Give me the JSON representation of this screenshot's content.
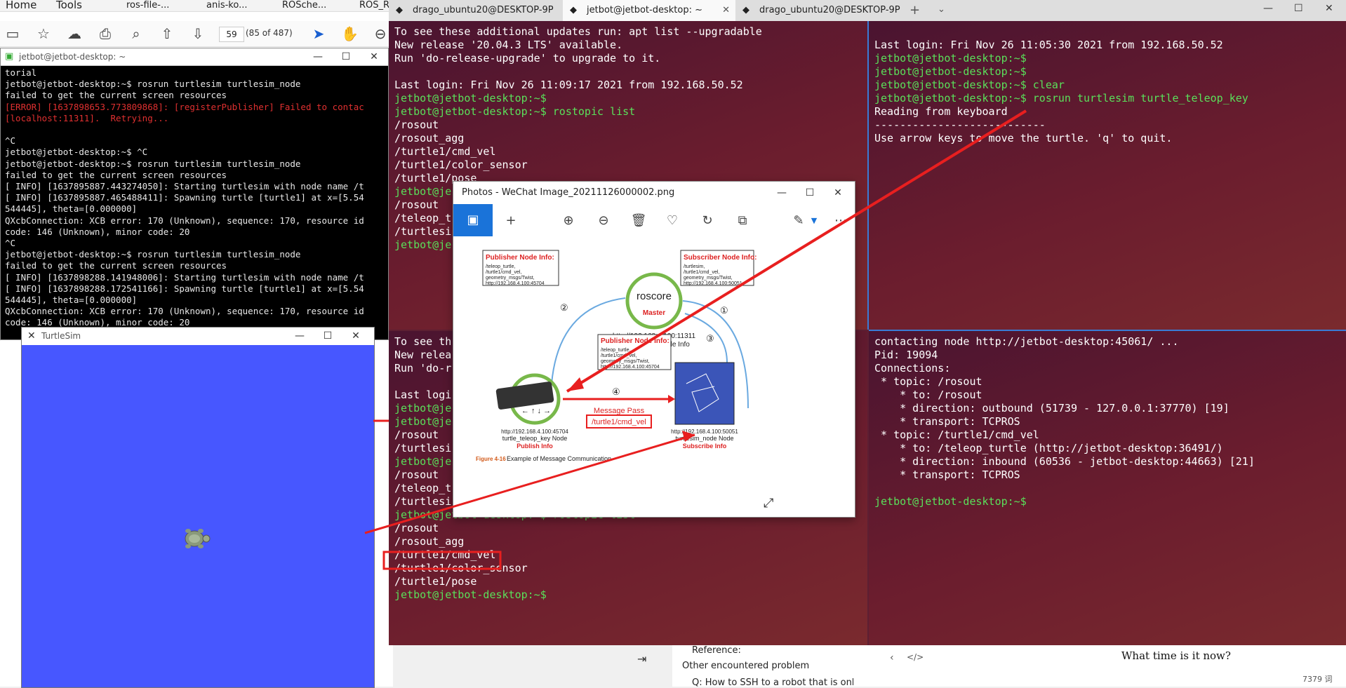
{
  "pdf_reader": {
    "menu": [
      "Home",
      "Tools"
    ],
    "tabs": [
      "ros-file-...",
      "anis-ko...",
      "ROSche...",
      "ROS_R"
    ],
    "page_input": "59",
    "page_count": "(85 of 487)"
  },
  "putty": {
    "title": "jetbot@jetbot-desktop: ~",
    "lines": [
      {
        "t": "torial",
        "c": ""
      },
      {
        "t": "jetbot@jetbot-desktop:~$ rosrun turtlesim turtlesim_node",
        "c": ""
      },
      {
        "t": "failed to get the current screen resources",
        "c": ""
      },
      {
        "t": "[ERROR] [1637898653.773809868]: [registerPublisher] Failed to contac",
        "c": "red"
      },
      {
        "t": "[localhost:11311].  Retrying...",
        "c": "red"
      },
      {
        "t": "",
        "c": ""
      },
      {
        "t": "^C",
        "c": ""
      },
      {
        "t": "jetbot@jetbot-desktop:~$ ^C",
        "c": ""
      },
      {
        "t": "jetbot@jetbot-desktop:~$ rosrun turtlesim turtlesim_node",
        "c": ""
      },
      {
        "t": "failed to get the current screen resources",
        "c": ""
      },
      {
        "t": "[ INFO] [1637895887.443274050]: Starting turtlesim with node name /t",
        "c": ""
      },
      {
        "t": "[ INFO] [1637895887.465488411]: Spawning turtle [turtle1] at x=[5.54",
        "c": ""
      },
      {
        "t": "544445], theta=[0.000000]",
        "c": ""
      },
      {
        "t": "QXcbConnection: XCB error: 170 (Unknown), sequence: 170, resource id",
        "c": ""
      },
      {
        "t": "code: 146 (Unknown), minor code: 20",
        "c": ""
      },
      {
        "t": "^C",
        "c": ""
      },
      {
        "t": "jetbot@jetbot-desktop:~$ rosrun turtlesim turtlesim_node",
        "c": ""
      },
      {
        "t": "failed to get the current screen resources",
        "c": ""
      },
      {
        "t": "[ INFO] [1637898288.141948006]: Starting turtlesim with node name /t",
        "c": ""
      },
      {
        "t": "[ INFO] [1637898288.172541166]: Spawning turtle [turtle1] at x=[5.54",
        "c": ""
      },
      {
        "t": "544445], theta=[0.000000]",
        "c": ""
      },
      {
        "t": "QXcbConnection: XCB error: 170 (Unknown), sequence: 170, resource id",
        "c": ""
      },
      {
        "t": "code: 146 (Unknown), minor code: 20",
        "c": ""
      }
    ]
  },
  "turtlesim": {
    "title": "TurtleSim"
  },
  "terminal": {
    "tabs": [
      {
        "label": "drago_ubuntu20@DESKTOP-9P"
      },
      {
        "label": "jetbot@jetbot-desktop: ~"
      },
      {
        "label": "drago_ubuntu20@DESKTOP-9P"
      }
    ],
    "pane_top_left": [
      {
        "t": "To see these additional updates run: apt list --upgradable",
        "c": ""
      },
      {
        "t": "New release '20.04.3 LTS' available.",
        "c": ""
      },
      {
        "t": "Run 'do-release-upgrade' to upgrade to it.",
        "c": ""
      },
      {
        "t": "",
        "c": ""
      },
      {
        "t": "Last login: Fri Nov 26 11:09:17 2021 from 192.168.50.52",
        "c": ""
      },
      {
        "t": "jetbot@jetbot-desktop:~$",
        "c": "g"
      },
      {
        "t": "jetbot@jetbot-desktop:~$ rostopic list",
        "c": "g"
      },
      {
        "t": "/rosout",
        "c": ""
      },
      {
        "t": "/rosout_agg",
        "c": ""
      },
      {
        "t": "/turtle1/cmd_vel",
        "c": ""
      },
      {
        "t": "/turtle1/color_sensor",
        "c": ""
      },
      {
        "t": "/turtle1/pose",
        "c": ""
      },
      {
        "t": "jetbot@je",
        "c": "g"
      },
      {
        "t": "/rosout",
        "c": ""
      },
      {
        "t": "/teleop_t",
        "c": ""
      },
      {
        "t": "/turtlesi",
        "c": ""
      },
      {
        "t": "jetbot@je",
        "c": "g"
      }
    ],
    "pane_top_right": [
      {
        "t": "",
        "c": ""
      },
      {
        "t": "Last login: Fri Nov 26 11:05:30 2021 from 192.168.50.52",
        "c": ""
      },
      {
        "t": "jetbot@jetbot-desktop:~$",
        "c": "g"
      },
      {
        "t": "jetbot@jetbot-desktop:~$",
        "c": "g"
      },
      {
        "t": "jetbot@jetbot-desktop:~$ clear",
        "c": "g"
      },
      {
        "t": "jetbot@jetbot-desktop:~$ rosrun turtlesim turtle_teleop_key",
        "c": "g"
      },
      {
        "t": "Reading from keyboard",
        "c": ""
      },
      {
        "t": "---------------------------",
        "c": ""
      },
      {
        "t": "Use arrow keys to move the turtle. 'q' to quit.",
        "c": ""
      }
    ],
    "pane_bottom_left": [
      {
        "t": "To see th",
        "c": ""
      },
      {
        "t": "New relea",
        "c": ""
      },
      {
        "t": "Run 'do-r",
        "c": ""
      },
      {
        "t": "",
        "c": ""
      },
      {
        "t": "Last logi",
        "c": ""
      },
      {
        "t": "jetbot@je",
        "c": "g"
      },
      {
        "t": "jetbot@je",
        "c": "g"
      },
      {
        "t": "/rosout",
        "c": ""
      },
      {
        "t": "/turtlesi",
        "c": ""
      },
      {
        "t": "jetbot@je",
        "c": "g"
      },
      {
        "t": "/rosout",
        "c": ""
      },
      {
        "t": "/teleop_t",
        "c": ""
      },
      {
        "t": "/turtlesi",
        "c": ""
      },
      {
        "t": "jetbot@jetbot-desktop:~$ rostopic list",
        "c": "g"
      },
      {
        "t": "/rosout",
        "c": ""
      },
      {
        "t": "/rosout_agg",
        "c": ""
      },
      {
        "t": "/turtle1/cmd_vel",
        "c": "box"
      },
      {
        "t": "/turtle1/color_sensor",
        "c": ""
      },
      {
        "t": "/turtle1/pose",
        "c": ""
      },
      {
        "t": "jetbot@jetbot-desktop:~$",
        "c": "g"
      }
    ],
    "pane_bottom_right": [
      {
        "t": "contacting node http://jetbot-desktop:45061/ ...",
        "c": ""
      },
      {
        "t": "Pid: 19094",
        "c": ""
      },
      {
        "t": "Connections:",
        "c": ""
      },
      {
        "t": " * topic: /rosout",
        "c": ""
      },
      {
        "t": "    * to: /rosout",
        "c": ""
      },
      {
        "t": "    * direction: outbound (51739 - 127.0.0.1:37770) [19]",
        "c": ""
      },
      {
        "t": "    * transport: TCPROS",
        "c": ""
      },
      {
        "t": " * topic: /turtle1/cmd_vel",
        "c": ""
      },
      {
        "t": "    * to: /teleop_turtle (http://jetbot-desktop:36491/)",
        "c": ""
      },
      {
        "t": "    * direction: inbound (60536 - jetbot-desktop:44663) [21]",
        "c": ""
      },
      {
        "t": "    * transport: TCPROS",
        "c": ""
      },
      {
        "t": "",
        "c": ""
      },
      {
        "t": "jetbot@jetbot-desktop:~$",
        "c": "g"
      }
    ]
  },
  "photos": {
    "title": "Photos - WeChat Image_20211126000002.png",
    "figure": {
      "roscore": "roscore",
      "master": "Master",
      "master_url": "http://192.168.4.100:11311",
      "admin_info": "Administrate Node Info",
      "pub_info_title": "Publisher Node Info:",
      "pub_info_lines": [
        "/teleop_turtle,",
        "/turtle1/cmd_vel,",
        "geometry_msgs/Twist,",
        "http://192.168.4.100:45704"
      ],
      "sub_info_title": "Subscriber Node Info:",
      "sub_info_lines": [
        "/turtlesim,",
        "/turtle1/cmd_vel,",
        "geometry_msgs/Twist,",
        "http://192.168.4.100:50051"
      ],
      "pub_info2_title": "Publisher Node Info:",
      "pub_info2_lines": [
        "/teleop_turtle,",
        "/turtle1/cmd_vel,",
        "geometry_msgs/Twist,",
        "http://192.168.4.100:45704"
      ],
      "n1": "①",
      "n2": "②",
      "n3": "③",
      "n4": "④",
      "msg_pass": "Message Pass",
      "msg_topic": "/turtle1/cmd_vel",
      "left_url": "http://192.168.4.100:45704",
      "left_node": "turtle_teleop_key Node",
      "left_role": "Publish Info",
      "right_url": "http://192.168.4.100:50051",
      "right_node": "turtlesim_node Node",
      "right_role": "Subscribe Info",
      "caption_label": "Figure 4-16",
      "caption_text": "Example of Message Communication",
      "keys": "← ↑ ↓ →"
    }
  },
  "bottom": {
    "reference": "Reference:",
    "other": "Other encountered problem",
    "q": "Q: How to SSH to a robot that is only",
    "comic_text": "What time is it now?",
    "count": "7379 词"
  },
  "colors": {
    "annotation_red": "#e81f1f",
    "terminal_green": "#5ae05a"
  }
}
